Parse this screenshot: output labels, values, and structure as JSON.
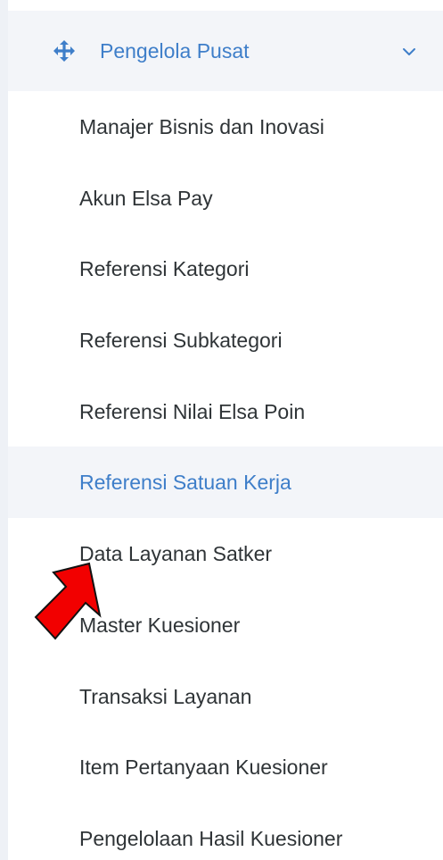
{
  "sidebar": {
    "group": {
      "label": "Pengelola Pusat",
      "icon": "move-arrows-icon",
      "expand_icon": "chevron-down-icon",
      "expanded": true
    },
    "items": [
      {
        "label": "Manajer Bisnis dan Inovasi"
      },
      {
        "label": "Akun Elsa Pay"
      },
      {
        "label": "Referensi Kategori"
      },
      {
        "label": "Referensi Subkategori"
      },
      {
        "label": "Referensi Nilai Elsa Poin"
      },
      {
        "label": "Referensi Satuan Kerja",
        "active": true
      },
      {
        "label": "Data Layanan Satker"
      },
      {
        "label": "Master Kuesioner"
      },
      {
        "label": "Transaksi Layanan"
      },
      {
        "label": "Item Pertanyaan Kuesioner"
      },
      {
        "label": "Pengelolaan Hasil Kuesioner"
      }
    ]
  },
  "annotation": {
    "icon": "red-arrow-pointer-icon",
    "color": "#f20000"
  },
  "colors": {
    "accent": "#3e7ec9",
    "active_background": "#f3f5f9",
    "text": "#2f3437"
  }
}
